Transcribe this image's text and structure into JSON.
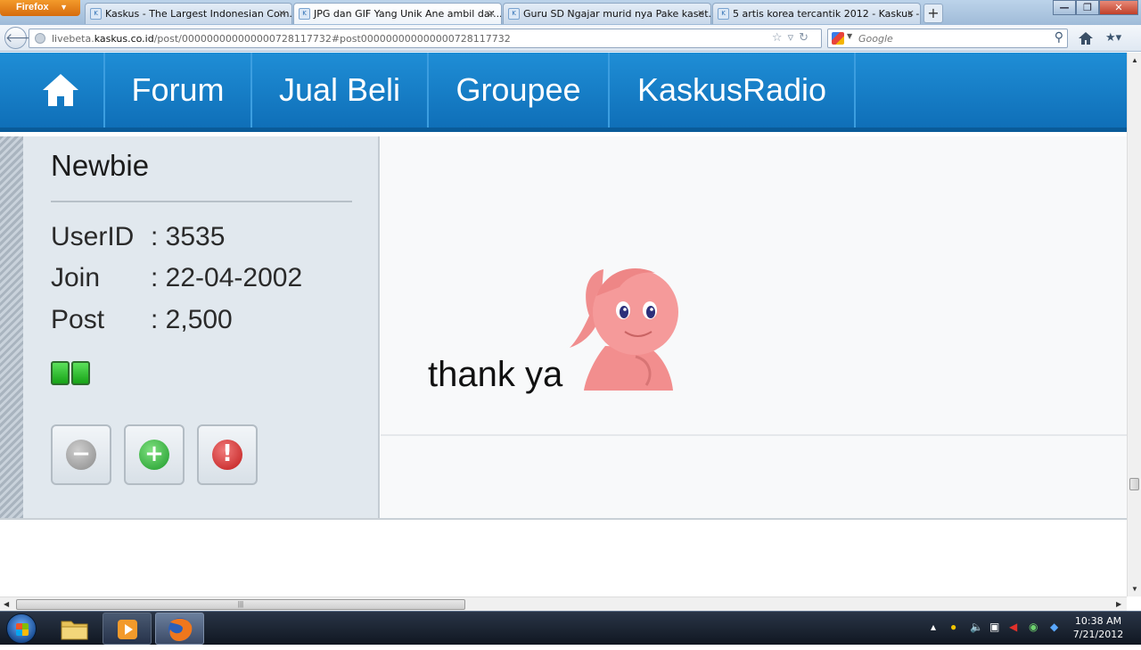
{
  "browser": {
    "app_button": "Firefox",
    "tabs": [
      {
        "title": "Kaskus - The Largest Indonesian Com..."
      },
      {
        "title": "JPG dan GIF Yang Unik Ane ambil dar..."
      },
      {
        "title": "Guru SD Ngajar murid nya Pake kaset..."
      },
      {
        "title": "5 artis korea tercantik 2012 - Kaskus - ..."
      }
    ],
    "url_prefix": "livebeta.",
    "url_domain": "kaskus.co.id",
    "url_path": "/post/000000000000000728117732#post000000000000000728117732",
    "search_placeholder": "Google"
  },
  "nav": {
    "items": [
      "Forum",
      "Jual Beli",
      "Groupee",
      "KaskusRadio"
    ]
  },
  "user": {
    "rank": "Newbie",
    "rows": [
      {
        "label": "UserID",
        "value": ": 3535"
      },
      {
        "label": "Join",
        "value": ": 22-04-2002"
      },
      {
        "label": "Post",
        "value": ": 2,500"
      }
    ]
  },
  "post": {
    "text": "thank ya"
  },
  "taskbar": {
    "time": "10:38 AM",
    "date": "7/21/2012"
  },
  "colors": {
    "nav_blue": "#1580c8",
    "panel_bg": "#e1e8ee",
    "rep_green": "#22b022"
  }
}
